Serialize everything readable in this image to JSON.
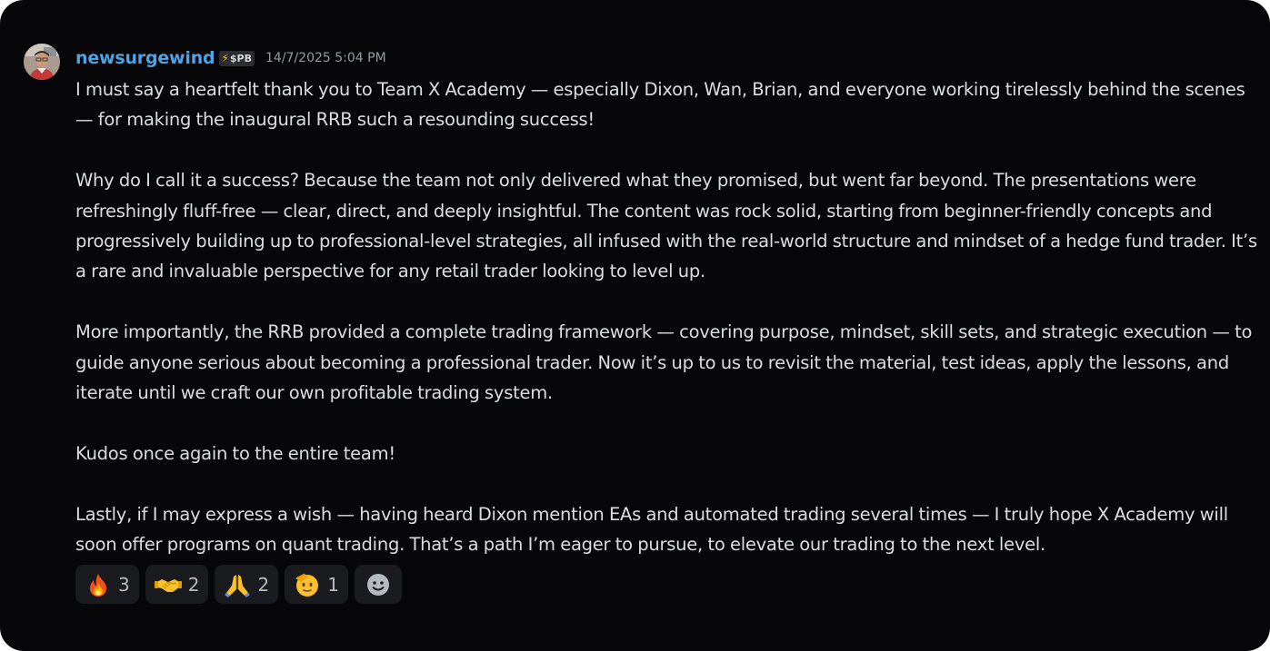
{
  "message": {
    "username": "newsurgewind",
    "tag": "$PB",
    "timestamp": "14/7/2025 5:04 PM",
    "paragraphs": [
      "I must say a heartfelt thank you to Team X Academy — especially Dixon, Wan, Brian, and everyone working tirelessly behind the scenes — for making the inaugural RRB such a resounding success!",
      "Why do I call it a success? Because the team not only delivered what they promised, but went far beyond. The presentations were refreshingly fluff-free — clear, direct, and deeply insightful. The content was rock solid, starting from beginner-friendly concepts and progressively building up to professional-level strategies, all infused with the real-world structure and mindset of a hedge fund trader. It’s a rare and invaluable perspective for any retail trader looking to level up.",
      "More importantly, the RRB provided a complete trading framework — covering purpose, mindset, skill sets, and strategic execution — to guide anyone serious about becoming a professional trader. Now it’s up to us to revisit the material, test ideas, apply the lessons, and iterate until we craft our own profitable trading system.",
      "Kudos once again to the entire team!",
      "Lastly, if I may express a wish — having heard Dixon mention EAs and automated trading several times — I truly hope X Academy will soon offer programs on quant trading. That’s a path I’m eager to pursue, to elevate our trading to the next level."
    ]
  },
  "reactions": [
    {
      "icon": "fire-emoji",
      "count": "3"
    },
    {
      "icon": "handshake-emoji",
      "count": "2"
    },
    {
      "icon": "folded-hands-emoji",
      "count": "2"
    },
    {
      "icon": "saluting-face-emoji",
      "count": "1"
    }
  ],
  "add_reaction_icon": "add-reaction-smiley-icon",
  "colors": {
    "background": "#070709",
    "username": "#4ca3e6",
    "text": "#dbdee1",
    "timestamp": "#949ba4",
    "reaction_bg": "#1a1b1e"
  }
}
